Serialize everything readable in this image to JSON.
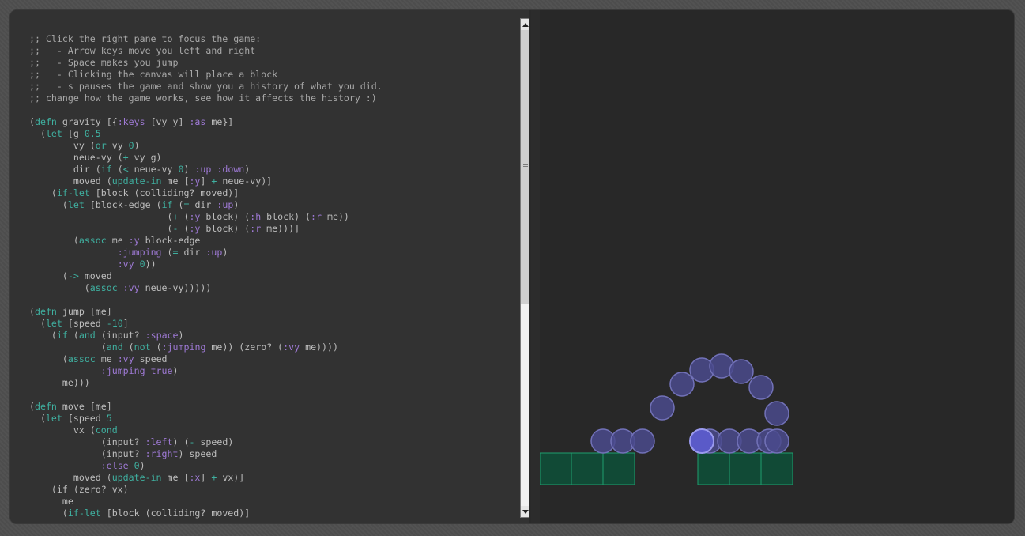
{
  "editor": {
    "lines": [
      [
        {
          "t": ";; Click the right pane to focus the game:",
          "c": "com"
        }
      ],
      [
        {
          "t": ";;   - Arrow keys move you left and right",
          "c": "com"
        }
      ],
      [
        {
          "t": ";;   - Space makes you jump",
          "c": "com"
        }
      ],
      [
        {
          "t": ";;   - Clicking the canvas will place a block",
          "c": "com"
        }
      ],
      [
        {
          "t": ";;   - s pauses the game and show you a history of what you did.",
          "c": "com"
        }
      ],
      [
        {
          "t": ";; change how the game works, see how it affects the history :)",
          "c": "com"
        }
      ],
      [],
      [
        {
          "t": "("
        },
        {
          "t": "defn",
          "c": "sp"
        },
        {
          "t": " gravity [{"
        },
        {
          "t": ":keys",
          "c": "kw"
        },
        {
          "t": " [vy y] "
        },
        {
          "t": ":as",
          "c": "kw"
        },
        {
          "t": " me}]"
        }
      ],
      [
        {
          "t": "  ("
        },
        {
          "t": "let",
          "c": "sp"
        },
        {
          "t": " [g "
        },
        {
          "t": "0.5",
          "c": "num"
        }
      ],
      [
        {
          "t": "        vy ("
        },
        {
          "t": "or",
          "c": "sp"
        },
        {
          "t": " vy "
        },
        {
          "t": "0",
          "c": "num"
        },
        {
          "t": ")"
        }
      ],
      [
        {
          "t": "        neue-vy ("
        },
        {
          "t": "+",
          "c": "sp"
        },
        {
          "t": " vy g)"
        }
      ],
      [
        {
          "t": "        dir ("
        },
        {
          "t": "if",
          "c": "sp"
        },
        {
          "t": " ("
        },
        {
          "t": "<",
          "c": "sp"
        },
        {
          "t": " neue-vy "
        },
        {
          "t": "0",
          "c": "num"
        },
        {
          "t": ") "
        },
        {
          "t": ":up",
          "c": "kw"
        },
        {
          "t": " "
        },
        {
          "t": ":down",
          "c": "kw"
        },
        {
          "t": ")"
        }
      ],
      [
        {
          "t": "        moved ("
        },
        {
          "t": "update-in",
          "c": "sp"
        },
        {
          "t": " me ["
        },
        {
          "t": ":y",
          "c": "kw"
        },
        {
          "t": "] "
        },
        {
          "t": "+",
          "c": "sp"
        },
        {
          "t": " neue-vy)]"
        }
      ],
      [
        {
          "t": "    ("
        },
        {
          "t": "if-let",
          "c": "sp"
        },
        {
          "t": " [block (colliding? moved)]"
        }
      ],
      [
        {
          "t": "      ("
        },
        {
          "t": "let",
          "c": "sp"
        },
        {
          "t": " [block-edge ("
        },
        {
          "t": "if",
          "c": "sp"
        },
        {
          "t": " ("
        },
        {
          "t": "=",
          "c": "sp"
        },
        {
          "t": " dir "
        },
        {
          "t": ":up",
          "c": "kw"
        },
        {
          "t": ")"
        }
      ],
      [
        {
          "t": "                         ("
        },
        {
          "t": "+",
          "c": "sp"
        },
        {
          "t": " ("
        },
        {
          "t": ":y",
          "c": "kw"
        },
        {
          "t": " block) ("
        },
        {
          "t": ":h",
          "c": "kw"
        },
        {
          "t": " block) ("
        },
        {
          "t": ":r",
          "c": "kw"
        },
        {
          "t": " me))"
        }
      ],
      [
        {
          "t": "                         ("
        },
        {
          "t": "-",
          "c": "sp"
        },
        {
          "t": " ("
        },
        {
          "t": ":y",
          "c": "kw"
        },
        {
          "t": " block) ("
        },
        {
          "t": ":r",
          "c": "kw"
        },
        {
          "t": " me)))]"
        }
      ],
      [
        {
          "t": "        ("
        },
        {
          "t": "assoc",
          "c": "sp"
        },
        {
          "t": " me "
        },
        {
          "t": ":y",
          "c": "kw"
        },
        {
          "t": " block-edge"
        }
      ],
      [
        {
          "t": "                "
        },
        {
          "t": ":jumping",
          "c": "kw"
        },
        {
          "t": " ("
        },
        {
          "t": "=",
          "c": "sp"
        },
        {
          "t": " dir "
        },
        {
          "t": ":up",
          "c": "kw"
        },
        {
          "t": ")"
        }
      ],
      [
        {
          "t": "                "
        },
        {
          "t": ":vy",
          "c": "kw"
        },
        {
          "t": " "
        },
        {
          "t": "0",
          "c": "num"
        },
        {
          "t": "))"
        }
      ],
      [
        {
          "t": "      ("
        },
        {
          "t": "->",
          "c": "sp"
        },
        {
          "t": " moved"
        }
      ],
      [
        {
          "t": "          ("
        },
        {
          "t": "assoc",
          "c": "sp"
        },
        {
          "t": " "
        },
        {
          "t": ":vy",
          "c": "kw"
        },
        {
          "t": " neue-vy)))))"
        }
      ],
      [],
      [
        {
          "t": "("
        },
        {
          "t": "defn",
          "c": "sp"
        },
        {
          "t": " jump [me]"
        }
      ],
      [
        {
          "t": "  ("
        },
        {
          "t": "let",
          "c": "sp"
        },
        {
          "t": " [speed "
        },
        {
          "t": "-10",
          "c": "num"
        },
        {
          "t": "]"
        }
      ],
      [
        {
          "t": "    ("
        },
        {
          "t": "if",
          "c": "sp"
        },
        {
          "t": " ("
        },
        {
          "t": "and",
          "c": "sp"
        },
        {
          "t": " (input? "
        },
        {
          "t": ":space",
          "c": "kw"
        },
        {
          "t": ")"
        }
      ],
      [
        {
          "t": "             ("
        },
        {
          "t": "and",
          "c": "sp"
        },
        {
          "t": " ("
        },
        {
          "t": "not",
          "c": "sp"
        },
        {
          "t": " ("
        },
        {
          "t": ":jumping",
          "c": "kw"
        },
        {
          "t": " me)) (zero? ("
        },
        {
          "t": ":vy",
          "c": "kw"
        },
        {
          "t": " me))))"
        }
      ],
      [
        {
          "t": "      ("
        },
        {
          "t": "assoc",
          "c": "sp"
        },
        {
          "t": " me "
        },
        {
          "t": ":vy",
          "c": "kw"
        },
        {
          "t": " speed"
        }
      ],
      [
        {
          "t": "             "
        },
        {
          "t": ":jumping",
          "c": "kw"
        },
        {
          "t": " "
        },
        {
          "t": "true",
          "c": "kw"
        },
        {
          "t": ")"
        }
      ],
      [
        {
          "t": "      me)))"
        }
      ],
      [],
      [
        {
          "t": "("
        },
        {
          "t": "defn",
          "c": "sp"
        },
        {
          "t": " move [me]"
        }
      ],
      [
        {
          "t": "  ("
        },
        {
          "t": "let",
          "c": "sp"
        },
        {
          "t": " [speed "
        },
        {
          "t": "5",
          "c": "num"
        }
      ],
      [
        {
          "t": "        vx ("
        },
        {
          "t": "cond",
          "c": "sp"
        }
      ],
      [
        {
          "t": "             (input? "
        },
        {
          "t": ":left",
          "c": "kw"
        },
        {
          "t": ") ("
        },
        {
          "t": "-",
          "c": "sp"
        },
        {
          "t": " speed)"
        }
      ],
      [
        {
          "t": "             (input? "
        },
        {
          "t": ":right",
          "c": "kw"
        },
        {
          "t": ") speed"
        }
      ],
      [
        {
          "t": "             "
        },
        {
          "t": ":else",
          "c": "kw"
        },
        {
          "t": " "
        },
        {
          "t": "0",
          "c": "num"
        },
        {
          "t": ")"
        }
      ],
      [
        {
          "t": "        moved ("
        },
        {
          "t": "update-in",
          "c": "sp"
        },
        {
          "t": " me ["
        },
        {
          "t": ":x",
          "c": "kw"
        },
        {
          "t": "] "
        },
        {
          "t": "+",
          "c": "sp"
        },
        {
          "t": " vx)]"
        }
      ],
      [
        {
          "t": "    (if (zero? vx)"
        }
      ],
      [
        {
          "t": "      me"
        }
      ],
      [
        {
          "t": "      ("
        },
        {
          "t": "if-let",
          "c": "sp"
        },
        {
          "t": " [block (colliding? moved)]"
        }
      ]
    ]
  },
  "scrollbar": {
    "visible_fraction": 0.55,
    "scroll_position": 0
  },
  "game": {
    "colors": {
      "background": "#282828",
      "ghost_fill": "#4a4a8c",
      "ghost_stroke": "#7272b8",
      "player_fill": "#5a5ac8",
      "player_stroke": "#9a9aee",
      "block_fill": "#114a36",
      "block_stroke": "#1e9e6e"
    }
  }
}
